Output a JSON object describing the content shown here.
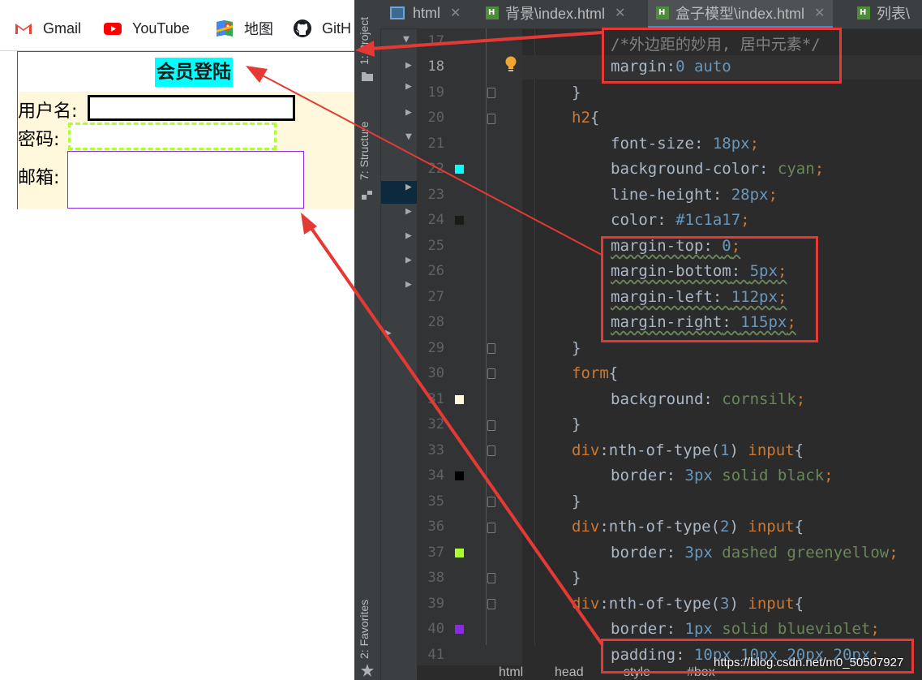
{
  "bookmarks": [
    {
      "label": "Gmail",
      "icon": "gmail-icon"
    },
    {
      "label": "YouTube",
      "icon": "youtube-icon"
    },
    {
      "label": "地图",
      "icon": "maps-icon"
    },
    {
      "label": "GitH",
      "icon": "github-icon"
    }
  ],
  "page": {
    "title": "会员登陆",
    "fields": [
      {
        "label": "用户名:"
      },
      {
        "label": "密码:"
      },
      {
        "label": "邮箱:"
      }
    ]
  },
  "ide": {
    "tabs": [
      {
        "label": "html",
        "icon": "html-file-icon"
      },
      {
        "label": "背景\\index.html",
        "icon": "html-file-icon"
      },
      {
        "label": "盒子模型\\index.html",
        "icon": "html-file-icon",
        "active": true
      },
      {
        "label": "列表\\",
        "icon": "html-file-icon"
      }
    ],
    "side_tabs": {
      "project": "1: Project",
      "structure": "7: Structure",
      "favorites": "2: Favorites"
    },
    "line_numbers": [
      "17",
      "18",
      "19",
      "20",
      "21",
      "22",
      "23",
      "24",
      "25",
      "26",
      "27",
      "28",
      "29",
      "30",
      "31",
      "32",
      "33",
      "34",
      "35",
      "36",
      "37",
      "38",
      "39",
      "40",
      "41"
    ],
    "swatches": [
      {
        "line": "22",
        "color": "#00ffff"
      },
      {
        "line": "24",
        "color": "#1c1a17"
      },
      {
        "line": "31",
        "color": "#fff8dc"
      },
      {
        "line": "34",
        "color": "#000000"
      },
      {
        "line": "37",
        "color": "#adff2f"
      },
      {
        "line": "40",
        "color": "#8a2be2"
      }
    ],
    "code": {
      "l17": "/*外边距的妙用, 居中元素*/",
      "l18_prop": "margin",
      "l18_val": "0 auto",
      "l19": "}",
      "l20_sel": "h2",
      "l20_brace": "{",
      "l21_prop": "font-size",
      "l21_val": "18px",
      "l22_prop": "background-color",
      "l22_val": "cyan",
      "l23_prop": "line-height",
      "l23_val": "28px",
      "l24_prop": "color",
      "l24_val": "#1c1a17",
      "l25_prop": "margin-top",
      "l25_val": "0",
      "l26_prop": "margin-bottom",
      "l26_val": "5px",
      "l27_prop": "margin-left",
      "l27_val": "112px",
      "l28_prop": "margin-right",
      "l28_val": "115px",
      "l29": "}",
      "l30_sel": "form",
      "l30_brace": "{",
      "l31_prop": "background",
      "l31_val": "cornsilk",
      "l32": "}",
      "l33_sel": "div",
      "l33_pseudo": ":nth-of-type(",
      "l33_num": "1",
      "l33_close": ")",
      "l33_el": "input",
      "l33_brace": "{",
      "l34_prop": "border",
      "l34_num": "3px",
      "l34_val": " solid black",
      "l35": "}",
      "l36_sel": "div",
      "l36_pseudo": ":nth-of-type(",
      "l36_num": "2",
      "l36_close": ")",
      "l36_el": "input",
      "l36_brace": "{",
      "l37_prop": "border",
      "l37_num": "3px",
      "l37_val": " dashed greenyellow",
      "l38": "}",
      "l39_sel": "div",
      "l39_pseudo": ":nth-of-type(",
      "l39_num": "3",
      "l39_close": ")",
      "l39_el": "input",
      "l39_brace": "{",
      "l40_prop": "border",
      "l40_num": "1px",
      "l40_val": " solid blueviolet",
      "l41_prop": "padding",
      "l41_val": "10px 10px 20px 20px"
    },
    "breadcrumb": [
      "html",
      "head",
      "style",
      "#box"
    ],
    "watermark": "https://blog.csdn.net/m0_50507927"
  },
  "annotations": {
    "color": "#e53935"
  }
}
